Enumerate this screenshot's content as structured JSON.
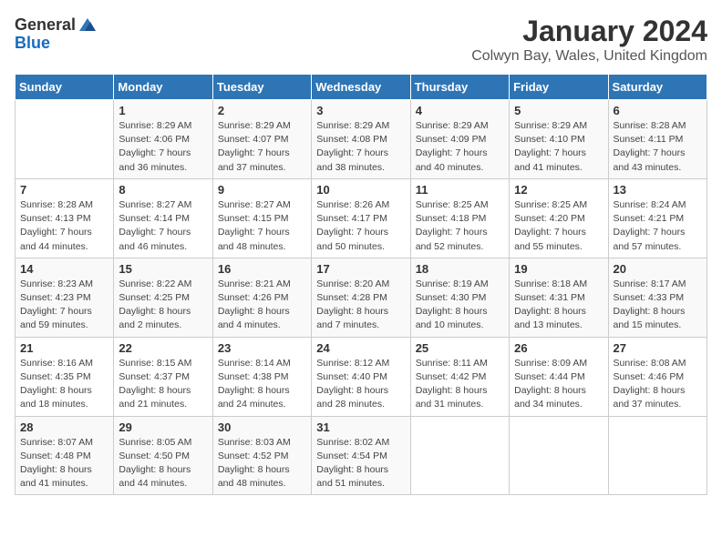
{
  "logo": {
    "general": "General",
    "blue": "Blue"
  },
  "title": "January 2024",
  "subtitle": "Colwyn Bay, Wales, United Kingdom",
  "days_of_week": [
    "Sunday",
    "Monday",
    "Tuesday",
    "Wednesday",
    "Thursday",
    "Friday",
    "Saturday"
  ],
  "weeks": [
    [
      {
        "day": "",
        "sunrise": "",
        "sunset": "",
        "daylight": ""
      },
      {
        "day": "1",
        "sunrise": "Sunrise: 8:29 AM",
        "sunset": "Sunset: 4:06 PM",
        "daylight": "Daylight: 7 hours and 36 minutes."
      },
      {
        "day": "2",
        "sunrise": "Sunrise: 8:29 AM",
        "sunset": "Sunset: 4:07 PM",
        "daylight": "Daylight: 7 hours and 37 minutes."
      },
      {
        "day": "3",
        "sunrise": "Sunrise: 8:29 AM",
        "sunset": "Sunset: 4:08 PM",
        "daylight": "Daylight: 7 hours and 38 minutes."
      },
      {
        "day": "4",
        "sunrise": "Sunrise: 8:29 AM",
        "sunset": "Sunset: 4:09 PM",
        "daylight": "Daylight: 7 hours and 40 minutes."
      },
      {
        "day": "5",
        "sunrise": "Sunrise: 8:29 AM",
        "sunset": "Sunset: 4:10 PM",
        "daylight": "Daylight: 7 hours and 41 minutes."
      },
      {
        "day": "6",
        "sunrise": "Sunrise: 8:28 AM",
        "sunset": "Sunset: 4:11 PM",
        "daylight": "Daylight: 7 hours and 43 minutes."
      }
    ],
    [
      {
        "day": "7",
        "sunrise": "Sunrise: 8:28 AM",
        "sunset": "Sunset: 4:13 PM",
        "daylight": "Daylight: 7 hours and 44 minutes."
      },
      {
        "day": "8",
        "sunrise": "Sunrise: 8:27 AM",
        "sunset": "Sunset: 4:14 PM",
        "daylight": "Daylight: 7 hours and 46 minutes."
      },
      {
        "day": "9",
        "sunrise": "Sunrise: 8:27 AM",
        "sunset": "Sunset: 4:15 PM",
        "daylight": "Daylight: 7 hours and 48 minutes."
      },
      {
        "day": "10",
        "sunrise": "Sunrise: 8:26 AM",
        "sunset": "Sunset: 4:17 PM",
        "daylight": "Daylight: 7 hours and 50 minutes."
      },
      {
        "day": "11",
        "sunrise": "Sunrise: 8:25 AM",
        "sunset": "Sunset: 4:18 PM",
        "daylight": "Daylight: 7 hours and 52 minutes."
      },
      {
        "day": "12",
        "sunrise": "Sunrise: 8:25 AM",
        "sunset": "Sunset: 4:20 PM",
        "daylight": "Daylight: 7 hours and 55 minutes."
      },
      {
        "day": "13",
        "sunrise": "Sunrise: 8:24 AM",
        "sunset": "Sunset: 4:21 PM",
        "daylight": "Daylight: 7 hours and 57 minutes."
      }
    ],
    [
      {
        "day": "14",
        "sunrise": "Sunrise: 8:23 AM",
        "sunset": "Sunset: 4:23 PM",
        "daylight": "Daylight: 7 hours and 59 minutes."
      },
      {
        "day": "15",
        "sunrise": "Sunrise: 8:22 AM",
        "sunset": "Sunset: 4:25 PM",
        "daylight": "Daylight: 8 hours and 2 minutes."
      },
      {
        "day": "16",
        "sunrise": "Sunrise: 8:21 AM",
        "sunset": "Sunset: 4:26 PM",
        "daylight": "Daylight: 8 hours and 4 minutes."
      },
      {
        "day": "17",
        "sunrise": "Sunrise: 8:20 AM",
        "sunset": "Sunset: 4:28 PM",
        "daylight": "Daylight: 8 hours and 7 minutes."
      },
      {
        "day": "18",
        "sunrise": "Sunrise: 8:19 AM",
        "sunset": "Sunset: 4:30 PM",
        "daylight": "Daylight: 8 hours and 10 minutes."
      },
      {
        "day": "19",
        "sunrise": "Sunrise: 8:18 AM",
        "sunset": "Sunset: 4:31 PM",
        "daylight": "Daylight: 8 hours and 13 minutes."
      },
      {
        "day": "20",
        "sunrise": "Sunrise: 8:17 AM",
        "sunset": "Sunset: 4:33 PM",
        "daylight": "Daylight: 8 hours and 15 minutes."
      }
    ],
    [
      {
        "day": "21",
        "sunrise": "Sunrise: 8:16 AM",
        "sunset": "Sunset: 4:35 PM",
        "daylight": "Daylight: 8 hours and 18 minutes."
      },
      {
        "day": "22",
        "sunrise": "Sunrise: 8:15 AM",
        "sunset": "Sunset: 4:37 PM",
        "daylight": "Daylight: 8 hours and 21 minutes."
      },
      {
        "day": "23",
        "sunrise": "Sunrise: 8:14 AM",
        "sunset": "Sunset: 4:38 PM",
        "daylight": "Daylight: 8 hours and 24 minutes."
      },
      {
        "day": "24",
        "sunrise": "Sunrise: 8:12 AM",
        "sunset": "Sunset: 4:40 PM",
        "daylight": "Daylight: 8 hours and 28 minutes."
      },
      {
        "day": "25",
        "sunrise": "Sunrise: 8:11 AM",
        "sunset": "Sunset: 4:42 PM",
        "daylight": "Daylight: 8 hours and 31 minutes."
      },
      {
        "day": "26",
        "sunrise": "Sunrise: 8:09 AM",
        "sunset": "Sunset: 4:44 PM",
        "daylight": "Daylight: 8 hours and 34 minutes."
      },
      {
        "day": "27",
        "sunrise": "Sunrise: 8:08 AM",
        "sunset": "Sunset: 4:46 PM",
        "daylight": "Daylight: 8 hours and 37 minutes."
      }
    ],
    [
      {
        "day": "28",
        "sunrise": "Sunrise: 8:07 AM",
        "sunset": "Sunset: 4:48 PM",
        "daylight": "Daylight: 8 hours and 41 minutes."
      },
      {
        "day": "29",
        "sunrise": "Sunrise: 8:05 AM",
        "sunset": "Sunset: 4:50 PM",
        "daylight": "Daylight: 8 hours and 44 minutes."
      },
      {
        "day": "30",
        "sunrise": "Sunrise: 8:03 AM",
        "sunset": "Sunset: 4:52 PM",
        "daylight": "Daylight: 8 hours and 48 minutes."
      },
      {
        "day": "31",
        "sunrise": "Sunrise: 8:02 AM",
        "sunset": "Sunset: 4:54 PM",
        "daylight": "Daylight: 8 hours and 51 minutes."
      },
      {
        "day": "",
        "sunrise": "",
        "sunset": "",
        "daylight": ""
      },
      {
        "day": "",
        "sunrise": "",
        "sunset": "",
        "daylight": ""
      },
      {
        "day": "",
        "sunrise": "",
        "sunset": "",
        "daylight": ""
      }
    ]
  ]
}
